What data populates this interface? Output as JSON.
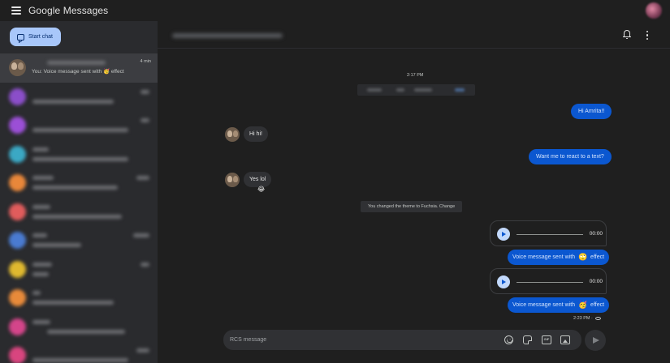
{
  "app": {
    "title": "Google Messages"
  },
  "sidebar": {
    "start_chat_label": "Start chat",
    "conversations": [
      {
        "time": "4 min",
        "snippet": "You: Voice message sent with",
        "snippet_emoji": "🥳",
        "snippet_suffix": "effect",
        "avatar_color": "#6b5a4a",
        "selected": true
      },
      {
        "avatar_color": "#8b4ec9"
      },
      {
        "avatar_color": "#9b4fd6"
      },
      {
        "avatar_color": "#3ba8c4"
      },
      {
        "avatar_color": "#e8873a"
      },
      {
        "avatar_color": "#e05c5c"
      },
      {
        "avatar_color": "#4a7bd1"
      },
      {
        "avatar_color": "#e0b92f"
      },
      {
        "avatar_color": "#e88a3a"
      },
      {
        "avatar_color": "#d4458a"
      },
      {
        "avatar_color": "#d8457f"
      }
    ]
  },
  "chat": {
    "timestamp_top": "2:17 PM",
    "messages": {
      "out_1": "Hi Amrita!!",
      "in_1": "Hi hi!",
      "out_2": "Want me to react to a text?",
      "in_2": "Yes lol",
      "in_2_reaction": "😂",
      "system": "You changed the theme to Fuchsia. Change",
      "voice_1_duration": "00:00",
      "voice_1_caption_prefix": "Voice message sent with",
      "voice_1_emoji": "🙄",
      "voice_1_caption_suffix": "effect",
      "voice_2_duration": "00:00",
      "voice_2_caption_prefix": "Voice message sent with",
      "voice_2_emoji": "🥳",
      "voice_2_caption_suffix": "effect",
      "last_time": "2:23 PM ·"
    }
  },
  "composer": {
    "placeholder": "RCS message"
  },
  "colors": {
    "accent": "#a8c7fa",
    "bubble_out": "#0b57d0",
    "bubble_in": "#303134",
    "background": "#1f1f1f"
  }
}
